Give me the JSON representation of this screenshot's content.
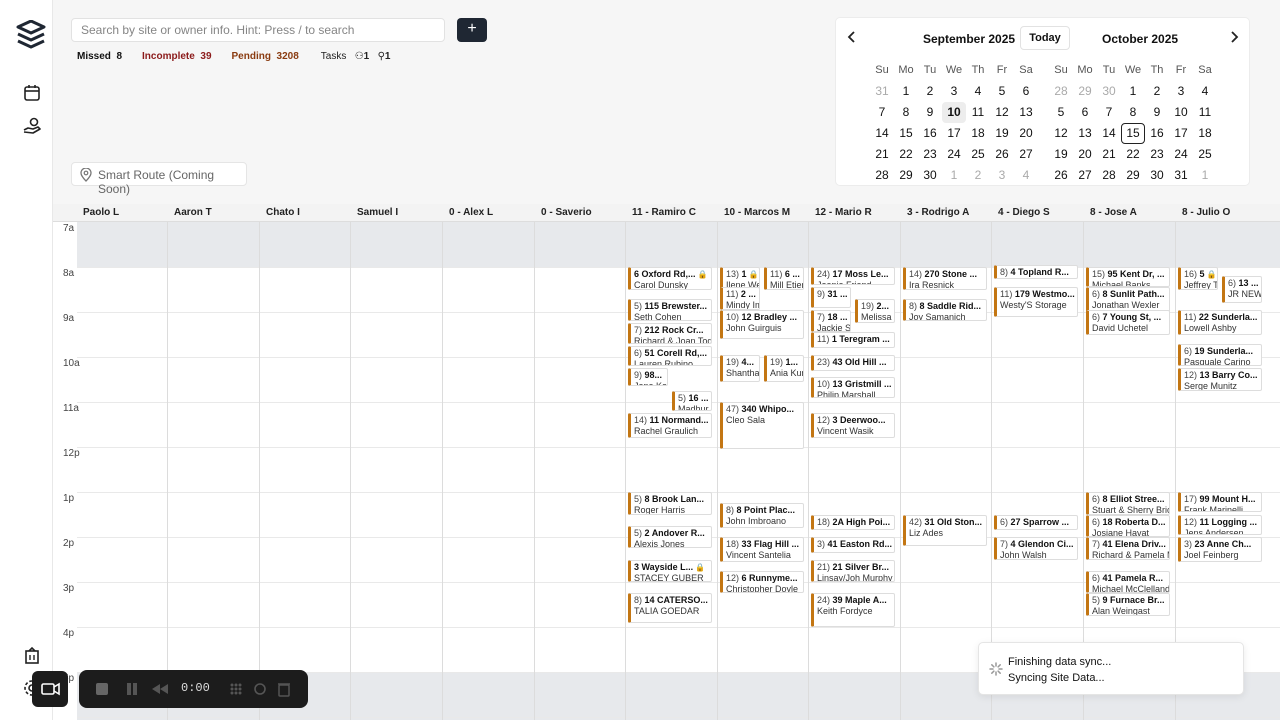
{
  "search": {
    "placeholder": "Search by site or owner info. Hint: Press / to search"
  },
  "add_label": "+",
  "stats": [
    {
      "label": "Missed",
      "value": "8",
      "color": "#111111"
    },
    {
      "label": "Incomplete",
      "value": "39",
      "color": "#8b1a1a"
    },
    {
      "label": "Pending",
      "value": "3208",
      "color": "#8a3b10"
    }
  ],
  "tasks": {
    "label": "Tasks",
    "a": "1",
    "b": "1"
  },
  "smart_route": "Smart Route (Coming Soon)",
  "calendar": {
    "today_label": "Today",
    "day_headers": [
      "Su",
      "Mo",
      "Tu",
      "We",
      "Th",
      "Fr",
      "Sa"
    ],
    "months": [
      {
        "title": "September 2025",
        "weeks": [
          [
            "31",
            "1",
            "2",
            "3",
            "4",
            "5",
            "6"
          ],
          [
            "7",
            "8",
            "9",
            "10",
            "11",
            "12",
            "13"
          ],
          [
            "14",
            "15",
            "16",
            "17",
            "18",
            "19",
            "20"
          ],
          [
            "21",
            "22",
            "23",
            "24",
            "25",
            "26",
            "27"
          ],
          [
            "28",
            "29",
            "30",
            "1",
            "2",
            "3",
            "4"
          ]
        ]
      },
      {
        "title": "October 2025",
        "weeks": [
          [
            "28",
            "29",
            "30",
            "1",
            "2",
            "3",
            "4"
          ],
          [
            "5",
            "6",
            "7",
            "8",
            "9",
            "10",
            "11"
          ],
          [
            "12",
            "13",
            "14",
            "15",
            "16",
            "17",
            "18"
          ],
          [
            "19",
            "20",
            "21",
            "22",
            "23",
            "24",
            "25"
          ],
          [
            "26",
            "27",
            "28",
            "29",
            "30",
            "31",
            "1"
          ]
        ]
      }
    ]
  },
  "columns": [
    "Paolo L",
    "Aaron T",
    "Chato I",
    "Samuel I",
    "0 - Alex L",
    "0 - Saverio",
    "11 - Ramiro C",
    "10 - Marcos M",
    "12 - Mario R",
    "3 - Rodrigo A",
    "4 - Diego S",
    "8 - Jose A",
    "8 - Julio O"
  ],
  "hours": [
    "7a",
    "8a",
    "9a",
    "10a",
    "11a",
    "12p",
    "1p",
    "2p",
    "3p",
    "4p",
    "5p"
  ],
  "appointments": [
    {
      "col": 6,
      "start": 8.0,
      "end": 8.5,
      "num": "",
      "title": "6 Oxford Rd,...",
      "owner": "Carol Dunsky",
      "lock": true
    },
    {
      "col": 6,
      "start": 8.7,
      "end": 9.2,
      "num": "5)",
      "title": "115 Brewster...",
      "owner": "Seth Cohen"
    },
    {
      "col": 6,
      "start": 9.25,
      "end": 9.7,
      "num": "7)",
      "title": "212 Rock Cr...",
      "owner": "Richard & Joan Todd"
    },
    {
      "col": 6,
      "start": 9.75,
      "end": 10.2,
      "num": "6)",
      "title": "51 Corell Rd,...",
      "owner": "Lauren Rubino"
    },
    {
      "col": 6,
      "start": 10.25,
      "end": 10.65,
      "num": "9)",
      "title": "98...",
      "owner": "Jane Kaul",
      "half": "left"
    },
    {
      "col": 6,
      "start": 10.75,
      "end": 11.2,
      "num": "5)",
      "title": "16 ...",
      "owner": "Madhur N",
      "half": "right"
    },
    {
      "col": 6,
      "start": 11.25,
      "end": 11.8,
      "num": "14)",
      "title": "11 Normand...",
      "owner": "Rachel Graulich"
    },
    {
      "col": 6,
      "start": 13.0,
      "end": 13.5,
      "num": "5)",
      "title": "8 Brook Lan...",
      "owner": "Roger Harris"
    },
    {
      "col": 6,
      "start": 13.75,
      "end": 14.25,
      "num": "5)",
      "title": "2 Andover R...",
      "owner": "Alexis Jones"
    },
    {
      "col": 6,
      "start": 14.5,
      "end": 15.0,
      "num": "",
      "title": "3 Wayside L...",
      "owner": "STACEY GUBER",
      "lock": true
    },
    {
      "col": 6,
      "start": 15.25,
      "end": 15.9,
      "num": "8)",
      "title": "14 CATERSO...",
      "owner": "TALIA GOEDAR"
    },
    {
      "col": 7,
      "start": 8.0,
      "end": 8.5,
      "num": "13)",
      "title": "1",
      "owner": "Ilene Wei",
      "half": "left",
      "lock": true
    },
    {
      "col": 7,
      "start": 8.0,
      "end": 8.5,
      "num": "11)",
      "title": "6 ...",
      "owner": "Mill Etien",
      "half": "right"
    },
    {
      "col": 7,
      "start": 8.45,
      "end": 8.95,
      "num": "11)",
      "title": "2 ...",
      "owner": "Mindy Im",
      "half": "left"
    },
    {
      "col": 7,
      "start": 8.95,
      "end": 9.6,
      "num": "10)",
      "title": "12 Bradley ...",
      "owner": "John Guirguis"
    },
    {
      "col": 7,
      "start": 9.95,
      "end": 10.55,
      "num": "19)",
      "title": "4...",
      "owner": "Shantha S",
      "half": "left"
    },
    {
      "col": 7,
      "start": 9.95,
      "end": 10.55,
      "num": "19)",
      "title": "1...",
      "owner": "Ania Kun",
      "half": "right"
    },
    {
      "col": 7,
      "start": 11.0,
      "end": 12.05,
      "num": "47)",
      "title": "340 Whipo...",
      "owner": "Cleo Sala"
    },
    {
      "col": 7,
      "start": 13.25,
      "end": 13.8,
      "num": "8)",
      "title": "8 Point Plac...",
      "owner": "John Imbroano"
    },
    {
      "col": 7,
      "start": 14.0,
      "end": 14.55,
      "num": "18)",
      "title": "33 Flag Hill ...",
      "owner": "Vincent Santelia"
    },
    {
      "col": 7,
      "start": 14.75,
      "end": 15.25,
      "num": "12)",
      "title": "6 Runnyme...",
      "owner": "Christopher Doyle"
    },
    {
      "col": 8,
      "start": 8.0,
      "end": 8.4,
      "num": "24)",
      "title": "17 Moss Le...",
      "owner": "Jeanie Friend"
    },
    {
      "col": 8,
      "start": 8.45,
      "end": 8.9,
      "num": "9)",
      "title": "31 ...",
      "owner": "",
      "half": "left"
    },
    {
      "col": 8,
      "start": 8.7,
      "end": 9.25,
      "num": "19)",
      "title": "2...",
      "owner": "Melissa F",
      "half": "right"
    },
    {
      "col": 8,
      "start": 8.95,
      "end": 9.45,
      "num": "7)",
      "title": "18 ...",
      "owner": "Jackie Sp",
      "half": "left"
    },
    {
      "col": 8,
      "start": 9.45,
      "end": 9.8,
      "num": "11)",
      "title": "1 Teregram ...",
      "owner": ""
    },
    {
      "col": 8,
      "start": 9.95,
      "end": 10.3,
      "num": "23)",
      "title": "43 Old Hill ...",
      "owner": ""
    },
    {
      "col": 8,
      "start": 10.45,
      "end": 10.9,
      "num": "10)",
      "title": "13 Gristmill ...",
      "owner": "Philip Marshall"
    },
    {
      "col": 8,
      "start": 11.25,
      "end": 11.8,
      "num": "12)",
      "title": "3 Deerwoo...",
      "owner": "Vincent Wasik"
    },
    {
      "col": 8,
      "start": 13.5,
      "end": 13.85,
      "num": "18)",
      "title": "2A High Poi...",
      "owner": ""
    },
    {
      "col": 8,
      "start": 14.0,
      "end": 14.35,
      "num": "3)",
      "title": "41 Easton Rd...",
      "owner": ""
    },
    {
      "col": 8,
      "start": 14.5,
      "end": 15.0,
      "num": "21)",
      "title": "21 Silver Br...",
      "owner": "Linsay/Joh Murphy"
    },
    {
      "col": 8,
      "start": 15.25,
      "end": 16.0,
      "num": "24)",
      "title": "39 Maple A...",
      "owner": "Keith Fordyce"
    },
    {
      "col": 9,
      "start": 8.0,
      "end": 8.5,
      "num": "14)",
      "title": "270 Stone ...",
      "owner": "Ira Resnick"
    },
    {
      "col": 9,
      "start": 8.7,
      "end": 9.2,
      "num": "8)",
      "title": "8 Saddle Rid...",
      "owner": "Joy Samanich"
    },
    {
      "col": 9,
      "start": 13.5,
      "end": 14.2,
      "num": "42)",
      "title": "31 Old Ston...",
      "owner": "Liz Ades"
    },
    {
      "col": 10,
      "start": 7.95,
      "end": 8.2,
      "num": "8)",
      "title": "4 Topland R...",
      "owner": ""
    },
    {
      "col": 10,
      "start": 8.45,
      "end": 9.1,
      "num": "11)",
      "title": "179 Westmo...",
      "owner": "Westy'S Storage"
    },
    {
      "col": 10,
      "start": 13.5,
      "end": 13.85,
      "num": "6)",
      "title": "27 Sparrow ...",
      "owner": ""
    },
    {
      "col": 10,
      "start": 14.0,
      "end": 14.5,
      "num": "7)",
      "title": "4 Glendon Ci...",
      "owner": "John Walsh"
    },
    {
      "col": 11,
      "start": 8.0,
      "end": 8.45,
      "num": "15)",
      "title": "95 Kent Dr, ...",
      "owner": "Michael Banks"
    },
    {
      "col": 11,
      "start": 8.45,
      "end": 9.0,
      "num": "6)",
      "title": "8 Sunlit Path...",
      "owner": "Jonathan Wexler"
    },
    {
      "col": 11,
      "start": 8.95,
      "end": 9.5,
      "num": "6)",
      "title": "7 Young St, ...",
      "owner": "David Uchetel"
    },
    {
      "col": 11,
      "start": 13.0,
      "end": 13.5,
      "num": "6)",
      "title": "8 Elliot Stree...",
      "owner": "Stuart & Sherry Brice"
    },
    {
      "col": 11,
      "start": 13.5,
      "end": 14.0,
      "num": "6)",
      "title": "18 Roberta D...",
      "owner": "Josiane Havat"
    },
    {
      "col": 11,
      "start": 14.0,
      "end": 14.5,
      "num": "7)",
      "title": "41 Elena Driv...",
      "owner": "Richard & Pamela M"
    },
    {
      "col": 11,
      "start": 14.75,
      "end": 15.25,
      "num": "6)",
      "title": "41 Pamela R...",
      "owner": "Michael McClelland"
    },
    {
      "col": 11,
      "start": 15.25,
      "end": 15.75,
      "num": "5)",
      "title": "9 Furnace Br...",
      "owner": "Alan Weingast"
    },
    {
      "col": 12,
      "start": 8.0,
      "end": 8.5,
      "num": "16)",
      "title": "5",
      "owner": "Jeffrey T",
      "half": "left",
      "lock": true
    },
    {
      "col": 12,
      "start": 8.2,
      "end": 8.8,
      "num": "6)",
      "title": "13 ...",
      "owner": "JR NEWM",
      "half": "right"
    },
    {
      "col": 12,
      "start": 8.95,
      "end": 9.5,
      "num": "11)",
      "title": "22 Sunderla...",
      "owner": "Lowell Ashby"
    },
    {
      "col": 12,
      "start": 9.7,
      "end": 10.2,
      "num": "6)",
      "title": "19 Sunderla...",
      "owner": "Pasquale Carino"
    },
    {
      "col": 12,
      "start": 10.25,
      "end": 10.75,
      "num": "12)",
      "title": "13 Barry Co...",
      "owner": "Serge Munitz"
    },
    {
      "col": 12,
      "start": 13.0,
      "end": 13.45,
      "num": "17)",
      "title": "99 Mount H...",
      "owner": "Frank Marinelli"
    },
    {
      "col": 12,
      "start": 13.5,
      "end": 13.95,
      "num": "12)",
      "title": "11 Logging ...",
      "owner": "Jens Andersen"
    },
    {
      "col": 12,
      "start": 14.0,
      "end": 14.55,
      "num": "3)",
      "title": "23 Anne Ch...",
      "owner": "Joel Feinberg"
    }
  ],
  "recorder": {
    "time": "0:00"
  },
  "toast": {
    "title": "Finishing data sync...",
    "subtitle": "Syncing Site Data..."
  },
  "colors": {
    "accent": "#c37613",
    "dark": "#1f2733"
  }
}
